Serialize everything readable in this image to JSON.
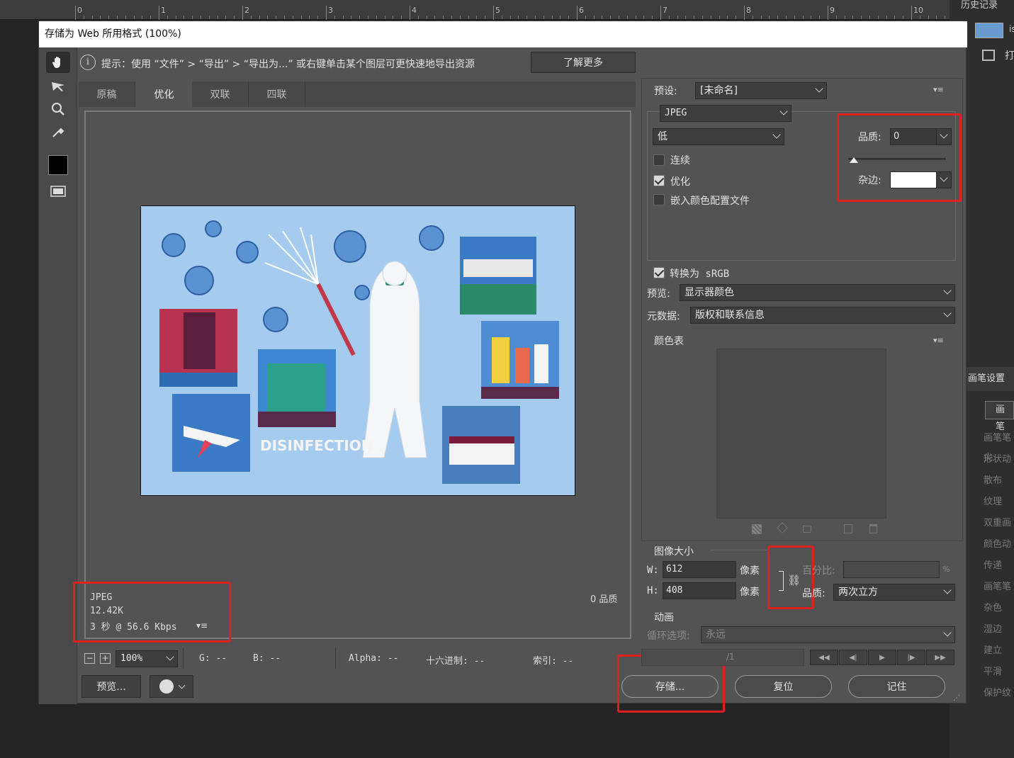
{
  "app": {
    "ruler_ticks": [
      "0",
      "1",
      "2",
      "3",
      "4",
      "5",
      "6",
      "7",
      "8",
      "9",
      "10"
    ],
    "dock_title": "历史记录",
    "dock_item_text": "is",
    "dock_item2": "打",
    "brush_settings": "画笔设置",
    "brush_btn": "画笔",
    "brush_items": [
      "画笔笔尖",
      "形状动",
      "散布",
      "纹理",
      "双重画",
      "颜色动",
      "传递",
      "画笔笔",
      "杂色",
      "湿边",
      "建立",
      "平滑",
      "保护纹"
    ]
  },
  "dialog": {
    "title": "存储为 Web 所用格式 (100%)",
    "hint": "提示：使用 “文件” > “导出” > “导出为...” 或右键单击某个图层可更快速地导出资源",
    "learn_more": "了解更多",
    "tabs": [
      "原稿",
      "优化",
      "双联",
      "四联"
    ],
    "active_tab": "优化",
    "image_text": "DISINFECTION",
    "info": {
      "format": "JPEG",
      "size": "12.42K",
      "time": "3 秒 @ 56.6 Kbps",
      "quality_readout": "0 品质"
    },
    "zoom": "100%",
    "status": {
      "g": "G: --",
      "b": "B: --",
      "alpha": "Alpha: --",
      "hex": "十六进制: --",
      "index": "索引: --"
    },
    "preview_btn": "预览...",
    "save_btn": "存储...",
    "reset_btn": "复位",
    "remember_btn": "记住"
  },
  "settings": {
    "preset_label": "预设:",
    "preset_value": "[未命名]",
    "format_value": "JPEG",
    "quality_level": "低",
    "progressive": {
      "label": "连续",
      "checked": false
    },
    "optimized": {
      "label": "优化",
      "checked": true
    },
    "embed_profile": {
      "label": "嵌入颜色配置文件",
      "checked": false
    },
    "quality_label": "品质:",
    "quality_value": "0",
    "quality_slider_fraction": 0.0,
    "matte_label": "杂边:",
    "matte_color": "#ffffff",
    "convert_srgb": {
      "label": "转换为 sRGB",
      "checked": true
    },
    "preview_label": "预览:",
    "preview_value": "显示器颜色",
    "metadata_label": "元数据:",
    "metadata_value": "版权和联系信息",
    "color_table_label": "颜色表",
    "image_size_label": "图像大小",
    "w_label": "W:",
    "w_value": "612",
    "h_label": "H:",
    "h_value": "408",
    "px_unit": "像素",
    "percent_label": "百分比:",
    "percent_sign": "%",
    "resample_label": "品质:",
    "resample_value": "两次立方",
    "animation_label": "动画",
    "loop_label": "循环选项:",
    "loop_value": "永远",
    "frame_counter": "/1"
  },
  "colors": {
    "highlight": "#e02020",
    "image_bg": "#a5ccee"
  }
}
